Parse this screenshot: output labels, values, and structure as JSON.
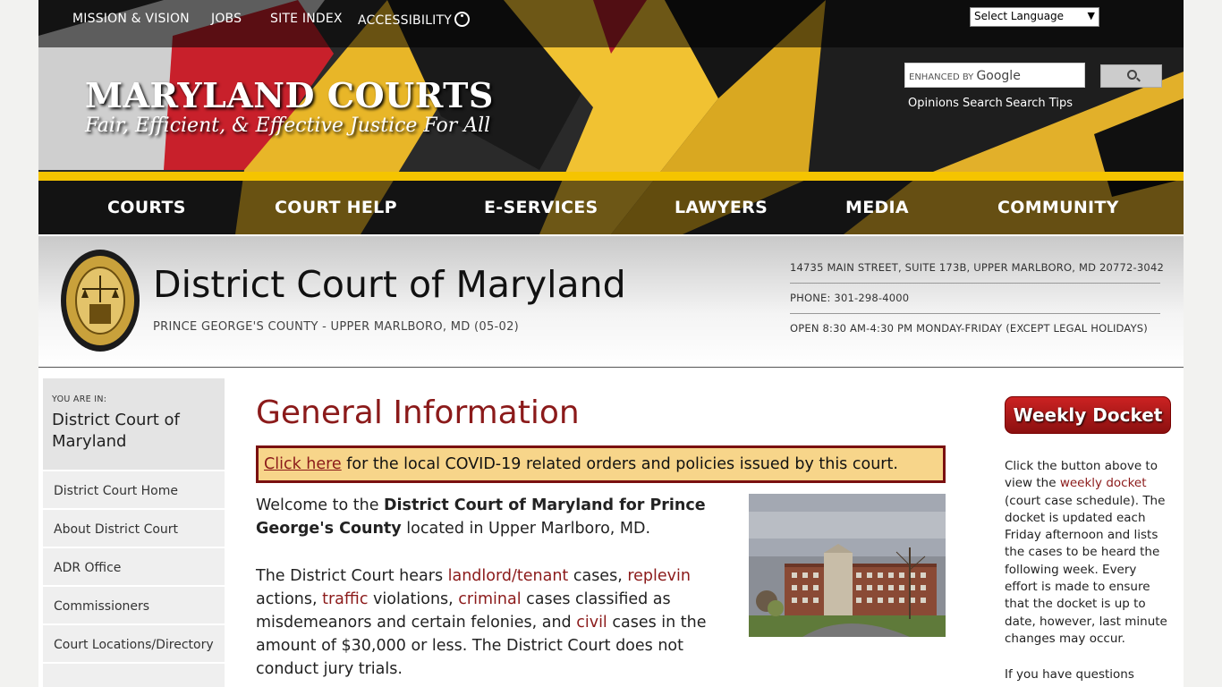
{
  "topnav": {
    "items": [
      "MISSION & VISION",
      "JOBS",
      "SITE INDEX",
      "ACCESSIBILITY"
    ],
    "language_select": "Select Language"
  },
  "brand": {
    "title": "MARYLAND COURTS",
    "tagline": "Fair, Efficient, & Effective Justice For All"
  },
  "search": {
    "placeholder_small": "ENHANCED BY",
    "placeholder_brand": "Google",
    "links": [
      "Opinions Search",
      "Search Tips"
    ]
  },
  "mainnav": {
    "items": [
      "COURTS",
      "COURT HELP",
      "E-SERVICES",
      "LAWYERS",
      "MEDIA",
      "COMMUNITY"
    ]
  },
  "court": {
    "name": "District Court of Maryland",
    "subtitle": "PRINCE GEORGE'S COUNTY - UPPER MARLBORO, MD (05-02)",
    "address": "14735 MAIN STREET, SUITE 173B, UPPER MARLBORO, MD 20772-3042",
    "phone": "PHONE: 301-298-4000",
    "hours": "OPEN 8:30 AM-4:30 PM MONDAY-FRIDAY (EXCEPT LEGAL HOLIDAYS)"
  },
  "sidebar": {
    "you_are_in_label": "YOU ARE IN:",
    "you_are_in_title": "District Court of Maryland",
    "items": [
      "District Court Home",
      "About District Court",
      "ADR Office",
      "Commissioners",
      "Court Locations/Directory"
    ]
  },
  "main": {
    "title": "General Information",
    "alert_link": "Click here",
    "alert_text": " for the local COVID-19 related orders and policies issued by this court.",
    "p1_a": "Welcome to the ",
    "p1_bold": "District Court of Maryland for Prince George's County",
    "p1_b": " located in Upper Marlboro, MD.",
    "p2": {
      "t1": "The District Court hears ",
      "l1": "landlord/tenant",
      "t2": " cases, ",
      "l2": "replevin",
      "t3": " actions, ",
      "l3": "traffic",
      "t4": " violations, ",
      "l4": "criminal",
      "t5": " cases classified as misdemeanors and certain felonies, and ",
      "l5": "civil",
      "t6": " cases in the amount of $30,000 or less. The District Court does not conduct jury trials."
    }
  },
  "right": {
    "docket_button": "Weekly Docket",
    "text_a": "Click the button above to view the ",
    "text_link": "weekly docket",
    "text_b": " (court case schedule). The docket is updated each Friday afternoon and lists the cases to be heard the following week. Every effort is made to ensure that the docket is up to date, however, last minute changes may occur.",
    "text2": "If you have questions"
  },
  "colors": {
    "accent_red": "#8b1a1a",
    "flag_yellow": "#f5c400",
    "alert_bg": "#f7d58a"
  }
}
